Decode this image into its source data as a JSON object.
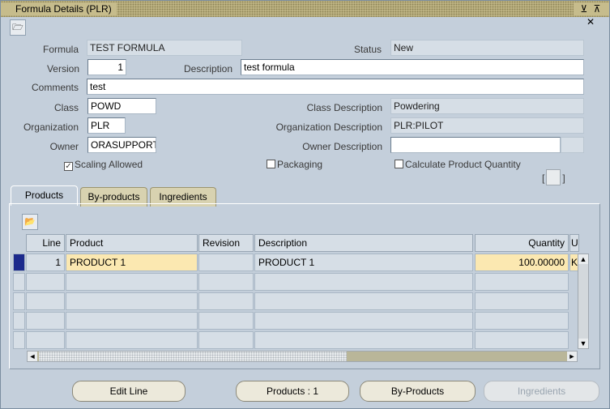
{
  "window": {
    "title": "Formula Details (PLR)",
    "controls": "⊻ ⊼ ✕"
  },
  "header": {
    "formula_label": "Formula",
    "formula_value": "TEST FORMULA",
    "status_label": "Status",
    "status_value": "New",
    "version_label": "Version",
    "version_value": "1",
    "description_label": "Description",
    "description_value": "test formula",
    "comments_label": "Comments",
    "comments_value": "test",
    "class_label": "Class",
    "class_value": "POWD",
    "class_desc_label": "Class Description",
    "class_desc_value": "Powdering",
    "org_label": "Organization",
    "org_value": "PLR",
    "org_desc_label": "Organization Description",
    "org_desc_value": "PLR:PILOT",
    "owner_label": "Owner",
    "owner_value": "ORASUPPORT",
    "owner_desc_label": "Owner Description",
    "owner_desc_value": ""
  },
  "checkboxes": {
    "scaling_label": "Scaling Allowed",
    "scaling_checked": true,
    "packaging_label": "Packaging",
    "packaging_checked": false,
    "calc_label": "Calculate Product Quantity",
    "calc_checked": false
  },
  "tabs": [
    {
      "label": "Products",
      "active": true
    },
    {
      "label": "By-products",
      "active": false
    },
    {
      "label": "Ingredients",
      "active": false
    }
  ],
  "grid": {
    "columns": [
      "Line",
      "Product",
      "Revision",
      "Description",
      "Quantity",
      "U"
    ],
    "rows": [
      {
        "line": "1",
        "product": "PRODUCT 1",
        "revision": "",
        "description": "PRODUCT 1",
        "quantity": "100.00000",
        "uom": "K"
      }
    ]
  },
  "buttons": {
    "edit_line": "Edit Line",
    "products": "Products : 1",
    "by_products": "By-Products",
    "ingredients": "Ingredients"
  },
  "colors": {
    "background": "#c4cfdb",
    "title_bar": "#c6bc8c",
    "highlight_cell": "#fbe8b1",
    "current_row": "#1c2a8c"
  }
}
